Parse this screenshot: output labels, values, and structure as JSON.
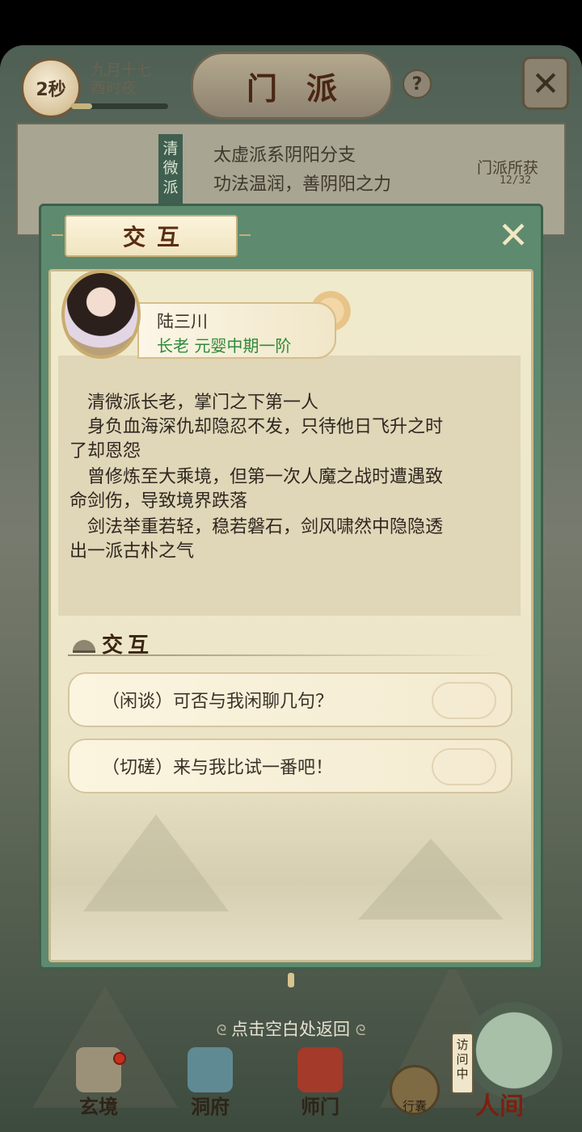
{
  "topbar": {
    "timer": "2秒",
    "date_line1": "九月十七",
    "date_line2": "酉时夜",
    "title": "门派",
    "help_icon": "?",
    "close_icon": "close-icon"
  },
  "sect": {
    "banner": "清微派",
    "line1": "太虚派系阴阳分支",
    "line2": "功法温润，善阴阳之力",
    "gain_label": "门派所获",
    "gain_count": "12/32"
  },
  "popup": {
    "tab_title": "交互",
    "close_icon": "close-icon",
    "character": {
      "name": "陆三川",
      "rank": "长老 元婴中期一阶"
    },
    "description": [
      "清微派长老，掌门之下第一人",
      "身负血海深仇却隐忍不发，只待他日飞升之时",
      "了却恩怨",
      "曾修炼至大乘境，但第一次人魔之战时遭遇致",
      "命剑伤，导致境界跌落",
      "剑法举重若轻，稳若磐石，剑风啸然中隐隐透",
      "出一派古朴之气"
    ],
    "section_title": "交互",
    "options": [
      "（闲谈）可否与我闲聊几句？",
      "（切磋）来与我比试一番吧！"
    ]
  },
  "back_hint": "点击空白处返回",
  "nav": {
    "items": [
      "玄境",
      "洞府",
      "师门"
    ],
    "bag_label": "行囊",
    "visiting": "访问中",
    "world": "人间"
  },
  "colors": {
    "rank_green": "#2f8a3a",
    "popup_frame": "#5e8a6f",
    "parchment": "#f0eacd"
  }
}
